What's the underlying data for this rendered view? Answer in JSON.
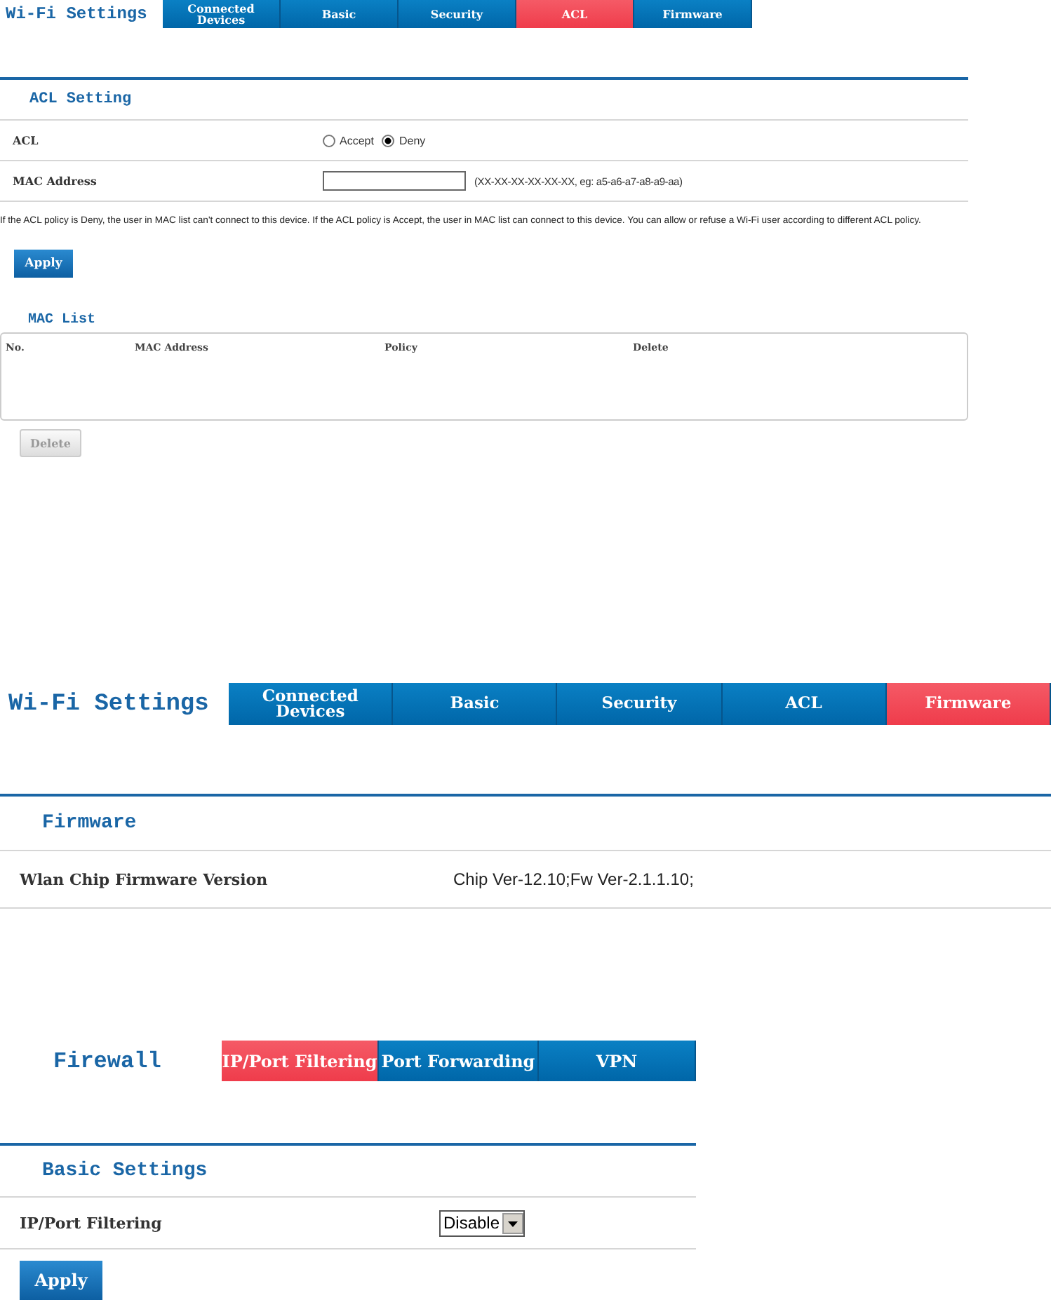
{
  "acl_page": {
    "title": "Wi-Fi Settings",
    "tabs": [
      {
        "label": "Connected Devices",
        "selected": false
      },
      {
        "label": "Basic",
        "selected": false
      },
      {
        "label": "Security",
        "selected": false
      },
      {
        "label": "ACL",
        "selected": true
      },
      {
        "label": "Firmware",
        "selected": false
      }
    ],
    "section_title": "ACL Setting",
    "acl": {
      "label": "ACL",
      "options": [
        {
          "label": "Accept",
          "selected": false
        },
        {
          "label": "Deny",
          "selected": true
        }
      ]
    },
    "mac_address": {
      "label": "MAC Address",
      "hint": "(XX-XX-XX-XX-XX-XX, eg: a5-a6-a7-a8-a9-aa)"
    },
    "note": "If the ACL policy is Deny, the user in MAC list can't connect to this device. If the ACL policy is Accept, the user in MAC list can connect to this device. You can allow or refuse a Wi-Fi user according to different ACL policy.",
    "apply_button": "Apply",
    "mac_list": {
      "title": "MAC List",
      "columns": [
        "No.",
        "MAC Address",
        "Policy",
        "Delete"
      ]
    },
    "delete_button": {
      "label": "Delete",
      "disabled": true
    }
  },
  "firmware_page": {
    "title": "Wi-Fi Settings",
    "tabs": [
      {
        "label": "Connected Devices",
        "selected": false
      },
      {
        "label": "Basic",
        "selected": false
      },
      {
        "label": "Security",
        "selected": false
      },
      {
        "label": "ACL",
        "selected": false
      },
      {
        "label": "Firmware",
        "selected": true
      }
    ],
    "section_title": "Firmware",
    "rows": [
      {
        "label": "Wlan Chip Firmware Version",
        "value": "Chip Ver-12.10;Fw Ver-2.1.1.10;"
      }
    ]
  },
  "firewall_page": {
    "title": "Firewall",
    "tabs": [
      {
        "label": "IP/Port Filtering",
        "selected": true
      },
      {
        "label": "Port Forwarding",
        "selected": false
      },
      {
        "label": "VPN",
        "selected": false
      }
    ],
    "section_title": "Basic Settings",
    "ip_port_filtering": {
      "label": "IP/Port Filtering",
      "value": "Disable"
    },
    "apply_button": "Apply"
  }
}
